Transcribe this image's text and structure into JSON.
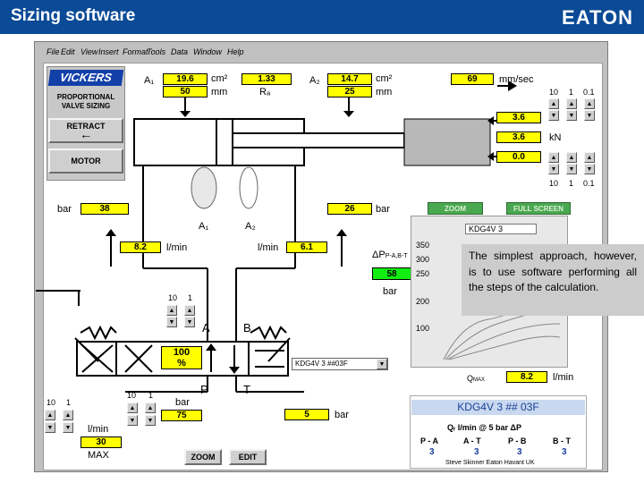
{
  "slide": {
    "title": "Sizing software",
    "logo": "EATON"
  },
  "menu": [
    "File",
    "Edit",
    "View",
    "Insert",
    "Format",
    "Tools",
    "Data",
    "Window",
    "Help"
  ],
  "brand": {
    "name": "VICKERS",
    "subtitle_1": "PROPORTIONAL",
    "subtitle_2": "VALVE SIZING"
  },
  "left_buttons": {
    "retract": "RETRACT",
    "motor": "MOTOR"
  },
  "cylinder": {
    "a1_label": "A₁",
    "a1_value": "19.6",
    "a1_unit": "cm²",
    "d1_value": "50",
    "d1_unit": "mm",
    "ratio_value": "1.33",
    "ratio_label": "Rₐ",
    "a2_label": "A₂",
    "a2_value": "14.7",
    "a2_unit": "cm²",
    "d2_value": "25",
    "d2_unit": "mm",
    "speed_value": "69",
    "speed_unit": "mm/sec",
    "force_values": [
      "3.6",
      "3.6",
      "0.0"
    ],
    "force_unit": "kN",
    "scale_top": [
      "10",
      "1",
      "0.1"
    ],
    "scale_bottom": [
      "10",
      "1",
      "0.1"
    ]
  },
  "pressures": {
    "p1_unit": "bar",
    "p1_value": "38",
    "p2_value": "26",
    "p2_unit": "bar",
    "area_labels": [
      "A₁",
      "A₂"
    ]
  },
  "flows": {
    "q1_value": "8.2",
    "q1_unit": "l/min",
    "q2_unit": "l/min",
    "q2_value": "6.1",
    "dp_label": "ΔP",
    "dp_sub": "P-A,B-T",
    "dp_value": "58",
    "dp_unit": "bar"
  },
  "valve": {
    "scale": [
      "10",
      "1"
    ],
    "port_a": "A",
    "port_b": "B",
    "port_p": "P",
    "port_t": "T",
    "opening_value": "100",
    "opening_unit": "%",
    "model_select": "KDG4V 3 ##03F"
  },
  "supply": {
    "scale": [
      "10",
      "1"
    ],
    "pressure_unit": "bar",
    "pressure_value": "75",
    "return_value": "5",
    "return_unit": "bar"
  },
  "pump": {
    "scale": [
      "10",
      "1"
    ],
    "unit": "l/min",
    "value": "30",
    "label": "MAX"
  },
  "bottom_buttons": {
    "zoom": "ZOOM",
    "edit": "EDIT"
  },
  "graph_panel": {
    "zoom": "ZOOM",
    "full_screen": "FULL SCREEN",
    "title": "KDG4V 3",
    "y_ticks": [
      "350",
      "300",
      "250",
      "200",
      "100"
    ],
    "qmax_label": "Q",
    "qmax_sub": "MAX",
    "qmax_value": "8.2",
    "qmax_unit": "l/min"
  },
  "callout": {
    "text": "The simplest approach, however, is to use software performing all the steps of the calculation."
  },
  "kdg_table": {
    "title": "KDG4V 3 ## 03F",
    "subheader": "Qᵣ l/min @ 5 bar ΔP",
    "columns": [
      "P - A",
      "A - T",
      "P - B",
      "B - T"
    ],
    "values": [
      "3",
      "3",
      "3",
      "3"
    ],
    "footer": "Steve Skinner Eaton Havant UK"
  },
  "colors": {
    "header": "#0a4a96",
    "yellow": "#ffff00",
    "green": "#11ee11",
    "accent": "#1a3f9a"
  }
}
